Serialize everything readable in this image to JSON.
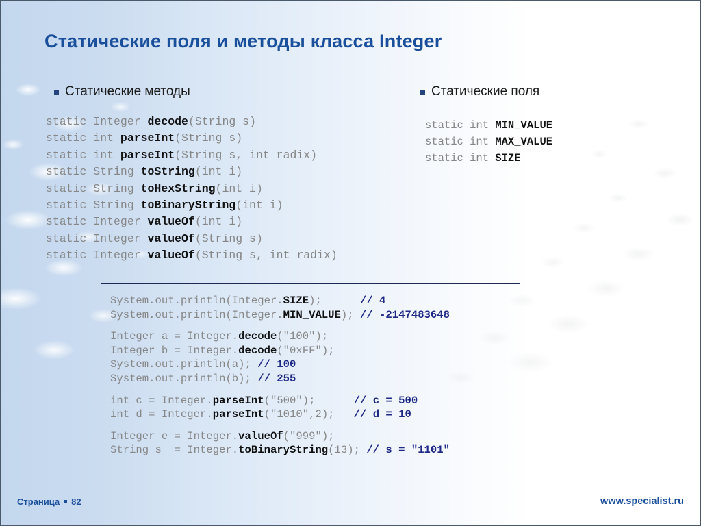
{
  "slide": {
    "title": "Статические поля и методы класса Integer",
    "accent_color": "#1a4f9c",
    "bullet_color": "#23447c",
    "code_color": "#878787",
    "code_bold_color": "#111111",
    "comment_color": "#1f2a86"
  },
  "methods_section": {
    "heading": "Статические методы",
    "bullet_glyph": "square-bullet",
    "lines": [
      {
        "plain1": "static Integer ",
        "bold": "decode",
        "plain2": "(String s)"
      },
      {
        "plain1": "static int ",
        "bold": "parseInt",
        "plain2": "(String s)"
      },
      {
        "plain1": "static int ",
        "bold": "parseInt",
        "plain2": "(String s, int radix)"
      },
      {
        "plain1": "static String ",
        "bold": "toString",
        "plain2": "(int i)"
      },
      {
        "plain1": "static String ",
        "bold": "toHexString",
        "plain2": "(int i)"
      },
      {
        "plain1": "static String ",
        "bold": "toBinaryString",
        "plain2": "(int i)"
      },
      {
        "plain1": "static Integer ",
        "bold": "valueOf",
        "plain2": "(int i)"
      },
      {
        "plain1": "static Integer ",
        "bold": "valueOf",
        "plain2": "(String s)"
      },
      {
        "plain1": "static Integer ",
        "bold": "valueOf",
        "plain2": "(String s, int radix)"
      }
    ]
  },
  "fields_section": {
    "heading": "Статические поля",
    "bullet_glyph": "square-bullet",
    "lines": [
      {
        "plain1": "static int ",
        "bold": "MIN_VALUE",
        "plain2": ""
      },
      {
        "plain1": "static int ",
        "bold": "MAX_VALUE",
        "plain2": ""
      },
      {
        "plain1": "static int ",
        "bold": "SIZE",
        "plain2": ""
      }
    ]
  },
  "example_section": {
    "lines": [
      {
        "type": "code",
        "plain1": "System.out.println(Integer.",
        "bold": "SIZE",
        "plain2": ");      ",
        "comment": "// 4"
      },
      {
        "type": "code",
        "plain1": "System.out.println(Integer.",
        "bold": "MIN_VALUE",
        "plain2": "); ",
        "comment": "// -2147483648"
      },
      {
        "type": "blank"
      },
      {
        "type": "code",
        "plain1": "Integer a = Integer.",
        "bold": "decode",
        "plain2": "(\"100\");",
        "comment": ""
      },
      {
        "type": "code",
        "plain1": "Integer b = Integer.",
        "bold": "decode",
        "plain2": "(\"0xFF\");",
        "comment": ""
      },
      {
        "type": "code",
        "plain1": "System.out.println(a); ",
        "bold": "",
        "plain2": "",
        "comment": "// 100"
      },
      {
        "type": "code",
        "plain1": "System.out.println(b); ",
        "bold": "",
        "plain2": "",
        "comment": "// 255"
      },
      {
        "type": "blank"
      },
      {
        "type": "code",
        "plain1": "int c = Integer.",
        "bold": "parseInt",
        "plain2": "(\"500\");      ",
        "comment": "// c = 500"
      },
      {
        "type": "code",
        "plain1": "int d = Integer.",
        "bold": "parseInt",
        "plain2": "(\"1010\",2);   ",
        "comment": "// d = 10"
      },
      {
        "type": "blank"
      },
      {
        "type": "code",
        "plain1": "Integer e = Integer.",
        "bold": "valueOf",
        "plain2": "(\"999\");",
        "comment": ""
      },
      {
        "type": "code",
        "plain1": "String s  = Integer.",
        "bold": "toBinaryString",
        "plain2": "(13); ",
        "comment": "// s = \"1101\""
      }
    ]
  },
  "footer": {
    "page_label": "Страница",
    "page_number": "82",
    "bullet_glyph": "square-bullet",
    "site": "www.specialist.ru"
  }
}
